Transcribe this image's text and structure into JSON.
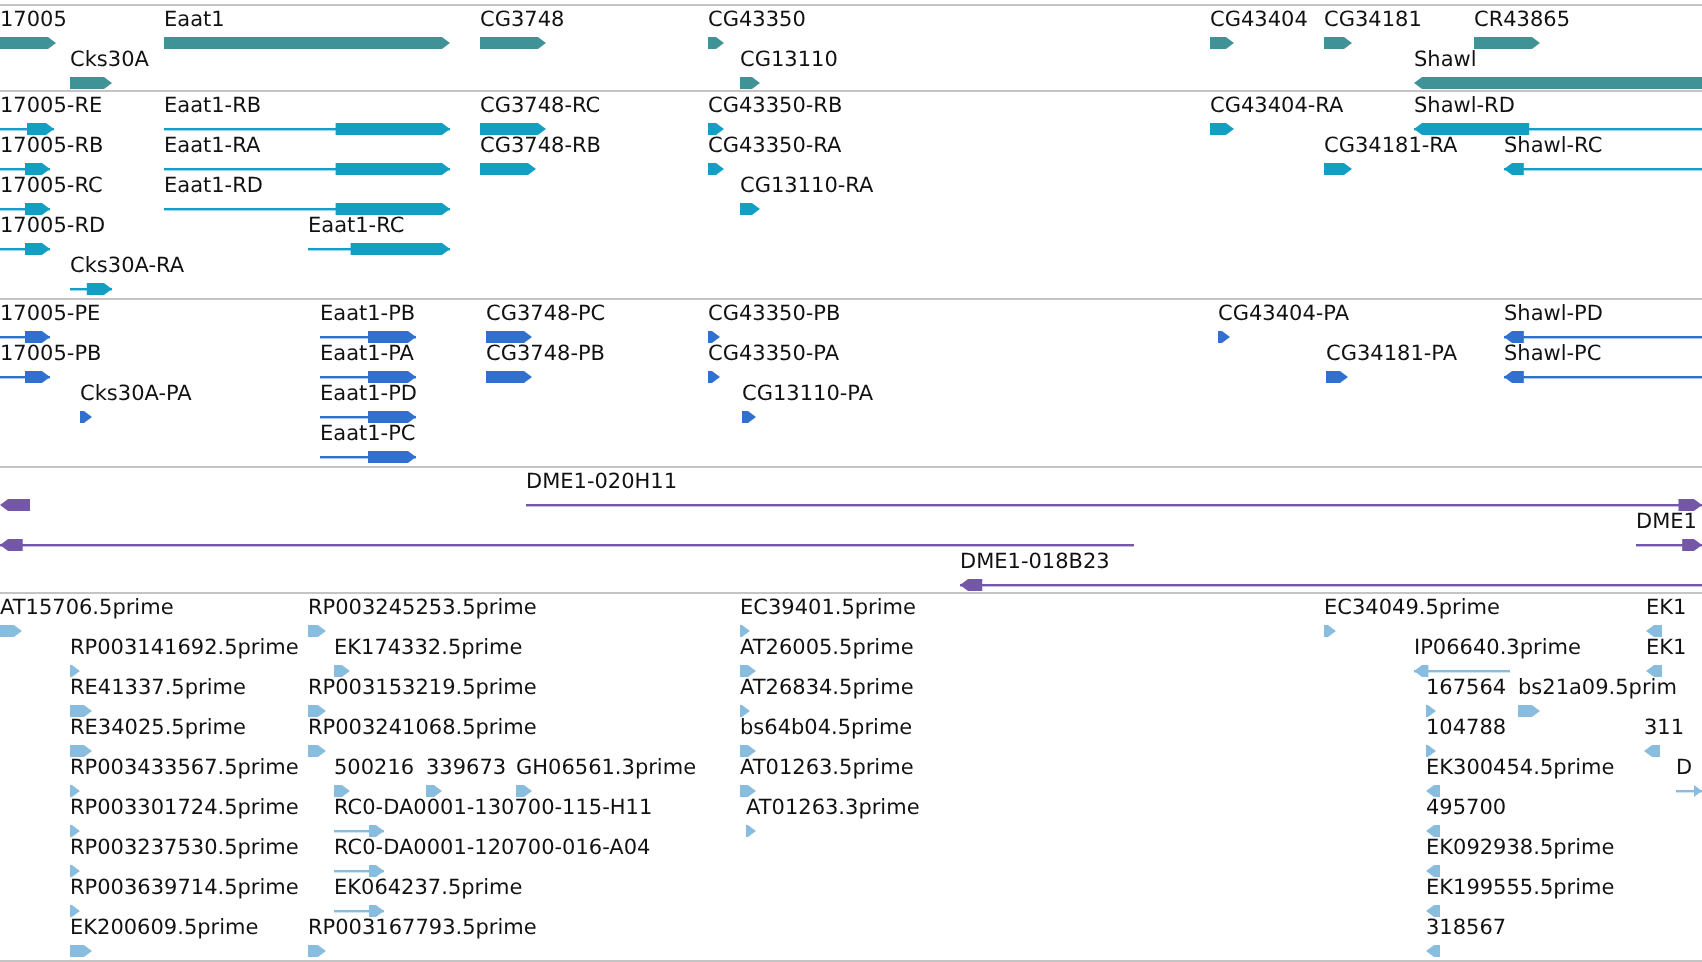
{
  "tracks": [
    {
      "color": "#3f9296",
      "features": [
        {
          "label": "17005",
          "reverse": false
        },
        {
          "label": "Eaat1",
          "reverse": false
        },
        {
          "label": "CG3748",
          "reverse": false
        },
        {
          "label": "CG43350",
          "reverse": false
        },
        {
          "label": "CG43404",
          "reverse": false
        },
        {
          "label": "CG34181",
          "reverse": false
        },
        {
          "label": "CR43865",
          "reverse": false
        },
        {
          "label": "Cks30A",
          "reverse": false
        },
        {
          "label": "CG13110",
          "reverse": false
        },
        {
          "label": "Shawl",
          "reverse": true
        }
      ]
    },
    {
      "color": "#119fc4",
      "features": [
        {
          "label": "17005-RE",
          "reverse": false
        },
        {
          "label": "17005-RB",
          "reverse": false
        },
        {
          "label": "17005-RC",
          "reverse": false
        },
        {
          "label": "17005-RD",
          "reverse": false
        },
        {
          "label": "Cks30A-RA",
          "reverse": false
        },
        {
          "label": "Eaat1-RB",
          "reverse": false
        },
        {
          "label": "Eaat1-RA",
          "reverse": false
        },
        {
          "label": "Eaat1-RD",
          "reverse": false
        },
        {
          "label": "Eaat1-RC",
          "reverse": false
        },
        {
          "label": "CG3748-RC",
          "reverse": false
        },
        {
          "label": "CG3748-RB",
          "reverse": false
        },
        {
          "label": "CG43350-RB",
          "reverse": false
        },
        {
          "label": "CG43350-RA",
          "reverse": false
        },
        {
          "label": "CG13110-RA",
          "reverse": false
        },
        {
          "label": "CG43404-RA",
          "reverse": false
        },
        {
          "label": "CG34181-RA",
          "reverse": false
        },
        {
          "label": "Shawl-RD",
          "reverse": true
        },
        {
          "label": "Shawl-RC",
          "reverse": true
        }
      ]
    },
    {
      "color": "#3070d0",
      "features": [
        {
          "label": "17005-PE",
          "reverse": false
        },
        {
          "label": "17005-PB",
          "reverse": false
        },
        {
          "label": "Cks30A-PA",
          "reverse": false
        },
        {
          "label": "Eaat1-PB",
          "reverse": false
        },
        {
          "label": "Eaat1-PA",
          "reverse": false
        },
        {
          "label": "Eaat1-PD",
          "reverse": false
        },
        {
          "label": "Eaat1-PC",
          "reverse": false
        },
        {
          "label": "CG3748-PC",
          "reverse": false
        },
        {
          "label": "CG3748-PB",
          "reverse": false
        },
        {
          "label": "CG43350-PB",
          "reverse": false
        },
        {
          "label": "CG43350-PA",
          "reverse": false
        },
        {
          "label": "CG13110-PA",
          "reverse": false
        },
        {
          "label": "CG43404-PA",
          "reverse": false
        },
        {
          "label": "CG34181-PA",
          "reverse": false
        },
        {
          "label": "Shawl-PD",
          "reverse": true
        },
        {
          "label": "Shawl-PC",
          "reverse": true
        }
      ]
    },
    {
      "color": "#7557aa",
      "features": [
        {
          "reverse": true
        },
        {
          "label": "DME1-020H11",
          "reverse": false
        },
        {
          "reverse": true
        },
        {
          "label": "DME1",
          "reverse": false
        },
        {
          "label": "DME1-018B23",
          "reverse": true
        }
      ]
    },
    {
      "color": "#88bde0",
      "features": [
        {
          "label": "AT15706.5prime",
          "reverse": false
        },
        {
          "label": "RP003141692.5prime",
          "reverse": false
        },
        {
          "label": "RE41337.5prime",
          "reverse": false
        },
        {
          "label": "RE34025.5prime",
          "reverse": false
        },
        {
          "label": "RP003433567.5prime",
          "reverse": false
        },
        {
          "label": "RP003301724.5prime",
          "reverse": false
        },
        {
          "label": "RP003237530.5prime",
          "reverse": false
        },
        {
          "label": "RP003639714.5prime",
          "reverse": false
        },
        {
          "label": "EK200609.5prime",
          "reverse": false
        },
        {
          "label": "RP003245253.5prime",
          "reverse": false
        },
        {
          "label": "EK174332.5prime",
          "reverse": false
        },
        {
          "label": "RP003153219.5prime",
          "reverse": false
        },
        {
          "label": "RP003241068.5prime",
          "reverse": false
        },
        {
          "label": "500216",
          "reverse": false
        },
        {
          "label": "339673",
          "reverse": false
        },
        {
          "label": "GH06561.3prime",
          "reverse": false
        },
        {
          "label": "RC0-DA0001-130700-115-H11",
          "reverse": false
        },
        {
          "label": "RC0-DA0001-120700-016-A04",
          "reverse": false
        },
        {
          "label": "EK064237.5prime",
          "reverse": false
        },
        {
          "label": "RP003167793.5prime",
          "reverse": false
        },
        {
          "label": "EC39401.5prime",
          "reverse": false
        },
        {
          "label": "AT26005.5prime",
          "reverse": false
        },
        {
          "label": "AT26834.5prime",
          "reverse": false
        },
        {
          "label": "bs64b04.5prime",
          "reverse": false
        },
        {
          "label": "AT01263.5prime",
          "reverse": false
        },
        {
          "label": "AT01263.3prime",
          "reverse": false
        },
        {
          "label": "EC34049.5prime",
          "reverse": false
        },
        {
          "label": "IP06640.3prime",
          "reverse": true
        },
        {
          "label": "167564",
          "reverse": false
        },
        {
          "label": "bs21a09.5prim",
          "reverse": false
        },
        {
          "label": "104788",
          "reverse": false
        },
        {
          "label": "EK300454.5prime",
          "reverse": true
        },
        {
          "label": "495700",
          "reverse": true
        },
        {
          "label": "EK092938.5prime",
          "reverse": true
        },
        {
          "label": "EK199555.5prime",
          "reverse": true
        },
        {
          "label": "318567",
          "reverse": true
        },
        {
          "label": "EK1",
          "reverse": true
        },
        {
          "label": "EK1",
          "reverse": true
        },
        {
          "label": "311",
          "reverse": true
        },
        {
          "label": "D",
          "reverse": false
        }
      ]
    }
  ]
}
